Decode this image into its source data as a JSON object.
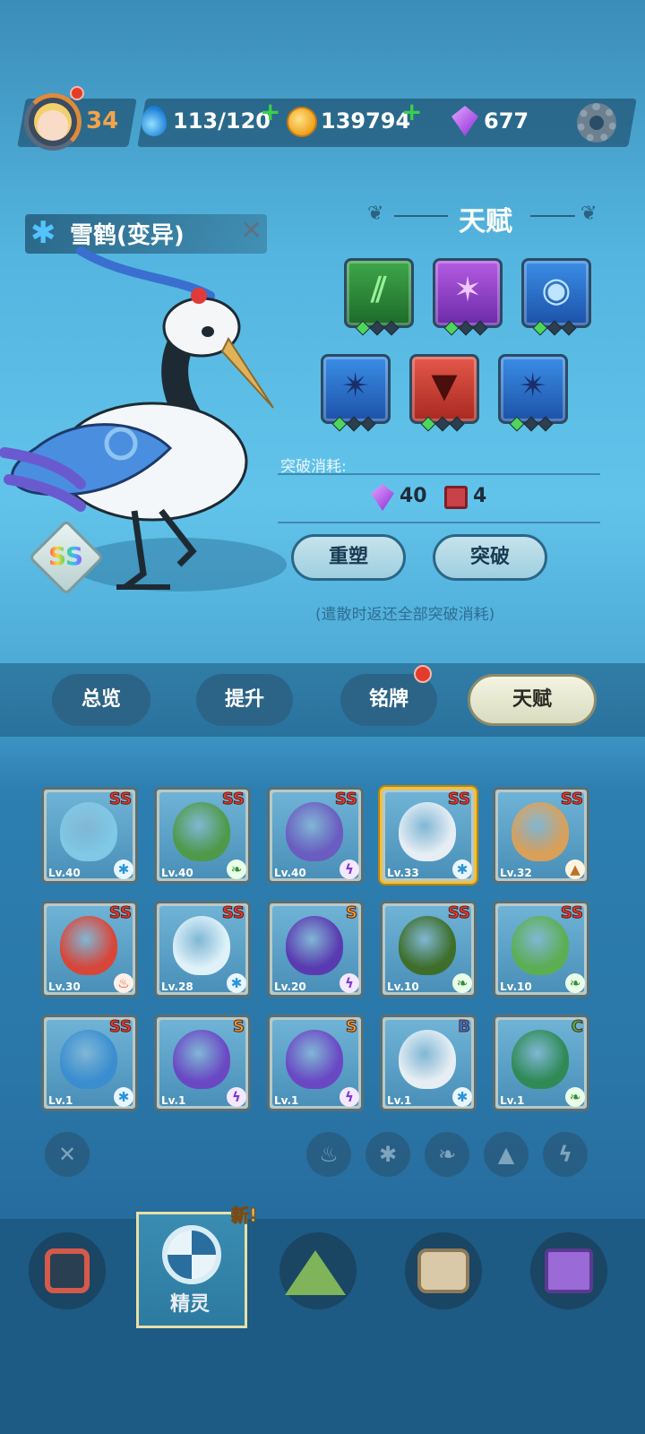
{
  "topbar": {
    "level": "34",
    "energy": "113/120",
    "coins": "139794",
    "gems": "677",
    "plus": "+"
  },
  "creature": {
    "name": "雪鹤(变异)",
    "rank": "SS"
  },
  "talent": {
    "title": "天赋",
    "icons": [
      {
        "kind": "claw-slash-icon",
        "color": "green",
        "pips_on": 1
      },
      {
        "kind": "star-burst-icon",
        "color": "purple",
        "pips_on": 1
      },
      {
        "kind": "eye-icon",
        "color": "blue",
        "pips_on": 1
      },
      {
        "kind": "spike-icon",
        "color": "blue",
        "pips_on": 1
      },
      {
        "kind": "fang-icon",
        "color": "red",
        "pips_on": 1
      },
      {
        "kind": "spike-icon",
        "color": "blue",
        "pips_on": 1
      }
    ],
    "break_cost_label": "突破消耗:",
    "cost_gems": "40",
    "cost_books": "4",
    "reshape_button": "重塑",
    "break_button": "突破",
    "note": "(遣散时返还全部突破消耗)"
  },
  "tabs": [
    "总览",
    "提升",
    "铭牌",
    "天赋"
  ],
  "active_tab": "天赋",
  "cards": [
    {
      "rank": "SS",
      "level": "Lv.40",
      "element": "ice",
      "color": "#7fc8e6"
    },
    {
      "rank": "SS",
      "level": "Lv.40",
      "element": "grass",
      "color": "#4e9a4a"
    },
    {
      "rank": "SS",
      "level": "Lv.40",
      "element": "thunder",
      "color": "#6a5cc0"
    },
    {
      "rank": "SS",
      "level": "Lv.33",
      "element": "ice",
      "color": "#e6eef4"
    },
    {
      "rank": "SS",
      "level": "Lv.32",
      "element": "earth",
      "color": "#d9a05a"
    },
    {
      "rank": "SS",
      "level": "Lv.30",
      "element": "fire",
      "color": "#d8463a"
    },
    {
      "rank": "SS",
      "level": "Lv.28",
      "element": "ice",
      "color": "#dff2fa"
    },
    {
      "rank": "S",
      "level": "Lv.20",
      "element": "thunder",
      "color": "#5a3ab0"
    },
    {
      "rank": "SS",
      "level": "Lv.10",
      "element": "grass",
      "color": "#3e6e2a"
    },
    {
      "rank": "SS",
      "level": "Lv.10",
      "element": "grass",
      "color": "#5cae52"
    },
    {
      "rank": "SS",
      "level": "Lv.1",
      "element": "ice",
      "color": "#3a8ed0"
    },
    {
      "rank": "S",
      "level": "Lv.1",
      "element": "thunder",
      "color": "#6a48c4"
    },
    {
      "rank": "S",
      "level": "Lv.1",
      "element": "thunder",
      "color": "#6a48c4"
    },
    {
      "rank": "B",
      "level": "Lv.1",
      "element": "ice",
      "color": "#e6eef4"
    },
    {
      "rank": "C",
      "level": "Lv.1",
      "element": "grass",
      "color": "#2f8a56"
    }
  ],
  "nav": {
    "active_label": "精灵",
    "new_badge": "新!"
  },
  "colors": {
    "rank_ss": "#e83a2a",
    "rank_s": "#f0a020",
    "rank_b": "#2a7ae0",
    "rank_c": "#3ab84a"
  }
}
